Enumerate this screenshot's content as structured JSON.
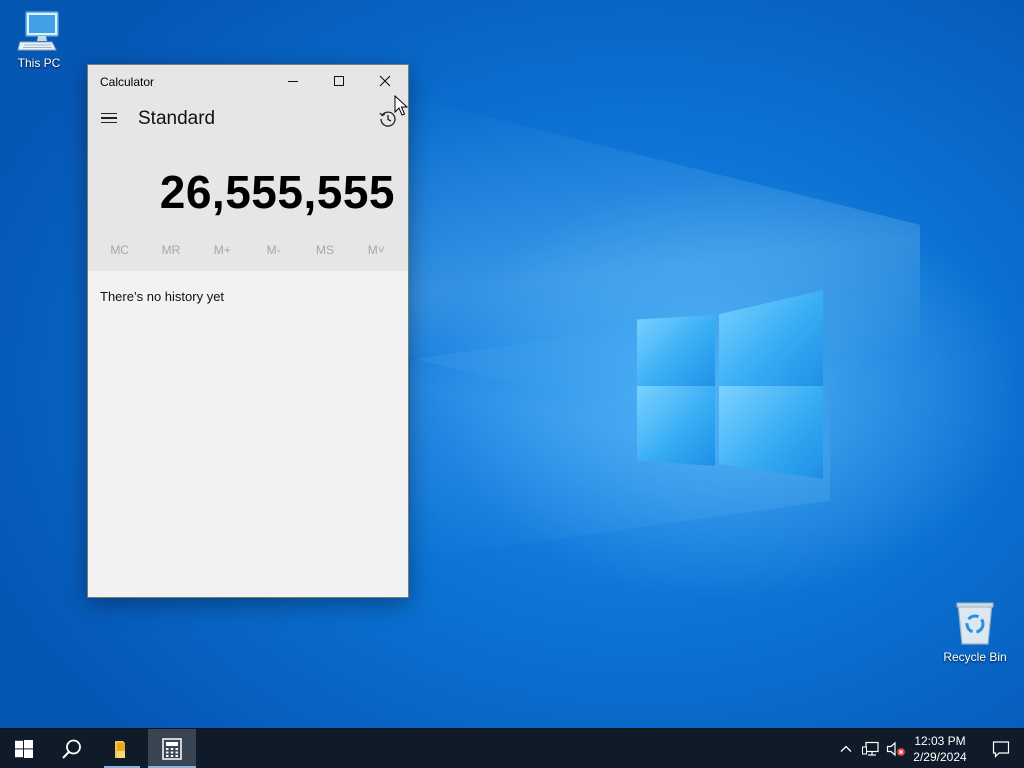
{
  "desktop": {
    "icons": [
      {
        "label": "This PC",
        "icon": "computer-icon"
      },
      {
        "label": "Recycle Bin",
        "icon": "recycle-bin-icon"
      }
    ],
    "accent_color": "#0a74d6"
  },
  "calculator": {
    "window_title": "Calculator",
    "mode_label": "Standard",
    "display_value": "26,555,555",
    "memory_buttons": [
      "MC",
      "MR",
      "M+",
      "M-",
      "MS",
      "M˅"
    ],
    "history_empty_message": "There’s no history yet",
    "icons": {
      "menu": "hamburger-icon",
      "history": "history-icon",
      "minimize": "minimize-icon",
      "maximize": "maximize-icon",
      "close": "close-icon"
    }
  },
  "taskbar": {
    "apps": [
      "start-icon",
      "search-icon",
      "file-explorer-icon",
      "calculator-icon"
    ],
    "active_app": "calculator-icon",
    "tray_icons": [
      "chevron-up-icon",
      "network-icon",
      "volume-muted-icon"
    ],
    "clock_time": "12:03 PM",
    "clock_date": "2/29/2024",
    "notification_icon": "action-center-icon",
    "background_color": "#101b29"
  }
}
